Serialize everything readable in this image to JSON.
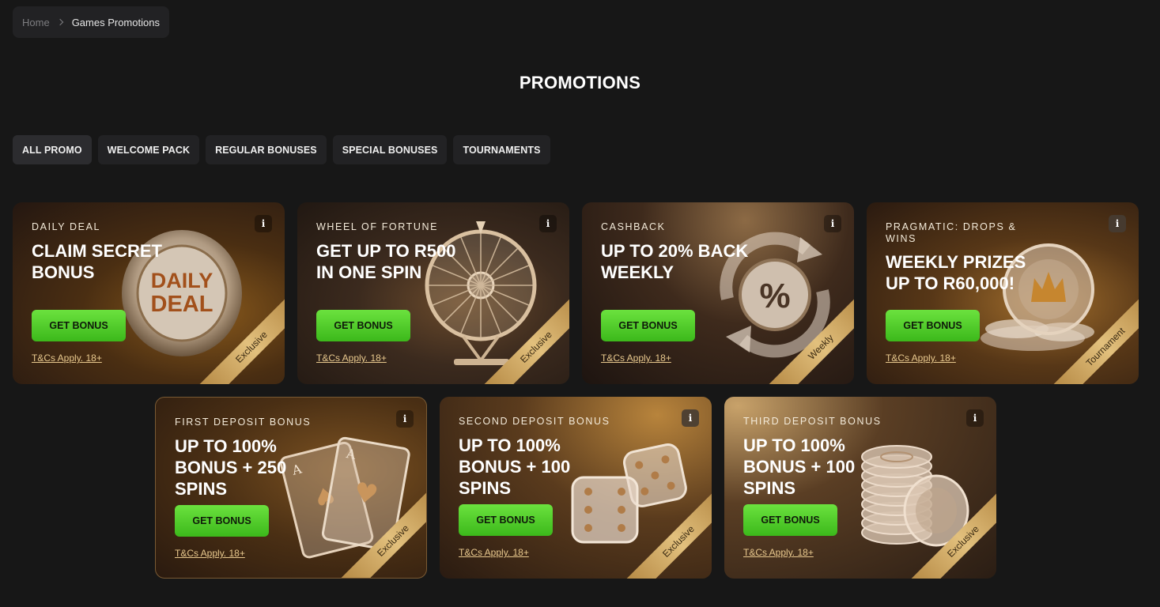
{
  "breadcrumb": {
    "home": "Home",
    "current": "Games Promotions"
  },
  "page_title": "PROMOTIONS",
  "tabs": [
    {
      "label": "ALL PROMO",
      "active": true
    },
    {
      "label": "WELCOME PACK",
      "active": false
    },
    {
      "label": "REGULAR BONUSES",
      "active": false
    },
    {
      "label": "SPECIAL BONUSES",
      "active": false
    },
    {
      "label": "TOURNAMENTS",
      "active": false
    }
  ],
  "cards": [
    {
      "eyebrow": "DAILY DEAL",
      "headline": "CLAIM SECRET BONUS",
      "cta": "GET BONUS",
      "terms": "T&Cs Apply. 18+",
      "ribbon": "Exclusive",
      "art_text": "DAILY DEAL"
    },
    {
      "eyebrow": "WHEEL OF FORTUNE",
      "headline": "GET UP TO R500 IN ONE SPIN",
      "cta": "GET BONUS",
      "terms": "T&Cs Apply. 18+",
      "ribbon": "Exclusive"
    },
    {
      "eyebrow": "CASHBACK",
      "headline": "UP TO 20% BACK WEEKLY",
      "cta": "GET BONUS",
      "terms": "T&Cs Apply. 18+",
      "ribbon": "Weekly",
      "art_text": "%"
    },
    {
      "eyebrow": "PRAGMATIC: DROPS & WINS",
      "headline": "WEEKLY PRIZES UP TO R60,000!",
      "cta": "GET BONUS",
      "terms": "T&Cs Apply. 18+",
      "ribbon": "Tournament"
    },
    {
      "eyebrow": "FIRST DEPOSIT BONUS",
      "headline": "UP TO 100% BONUS + 250 SPINS",
      "cta": "GET BONUS",
      "terms": "T&Cs Apply. 18+",
      "ribbon": "Exclusive"
    },
    {
      "eyebrow": "SECOND DEPOSIT BONUS",
      "headline": "UP TO 100% BONUS + 100 SPINS",
      "cta": "GET BONUS",
      "terms": "T&Cs Apply. 18+",
      "ribbon": "Exclusive"
    },
    {
      "eyebrow": "THIRD DEPOSIT BONUS",
      "headline": "UP TO 100% BONUS + 100 SPINS",
      "cta": "GET BONUS",
      "terms": "T&Cs Apply. 18+",
      "ribbon": "Exclusive"
    }
  ],
  "info_icon": "info-icon",
  "colors": {
    "cta": "#4fcf26",
    "terms": "#e9c98e",
    "ribbon": "#d4ad68",
    "background": "#171717"
  }
}
